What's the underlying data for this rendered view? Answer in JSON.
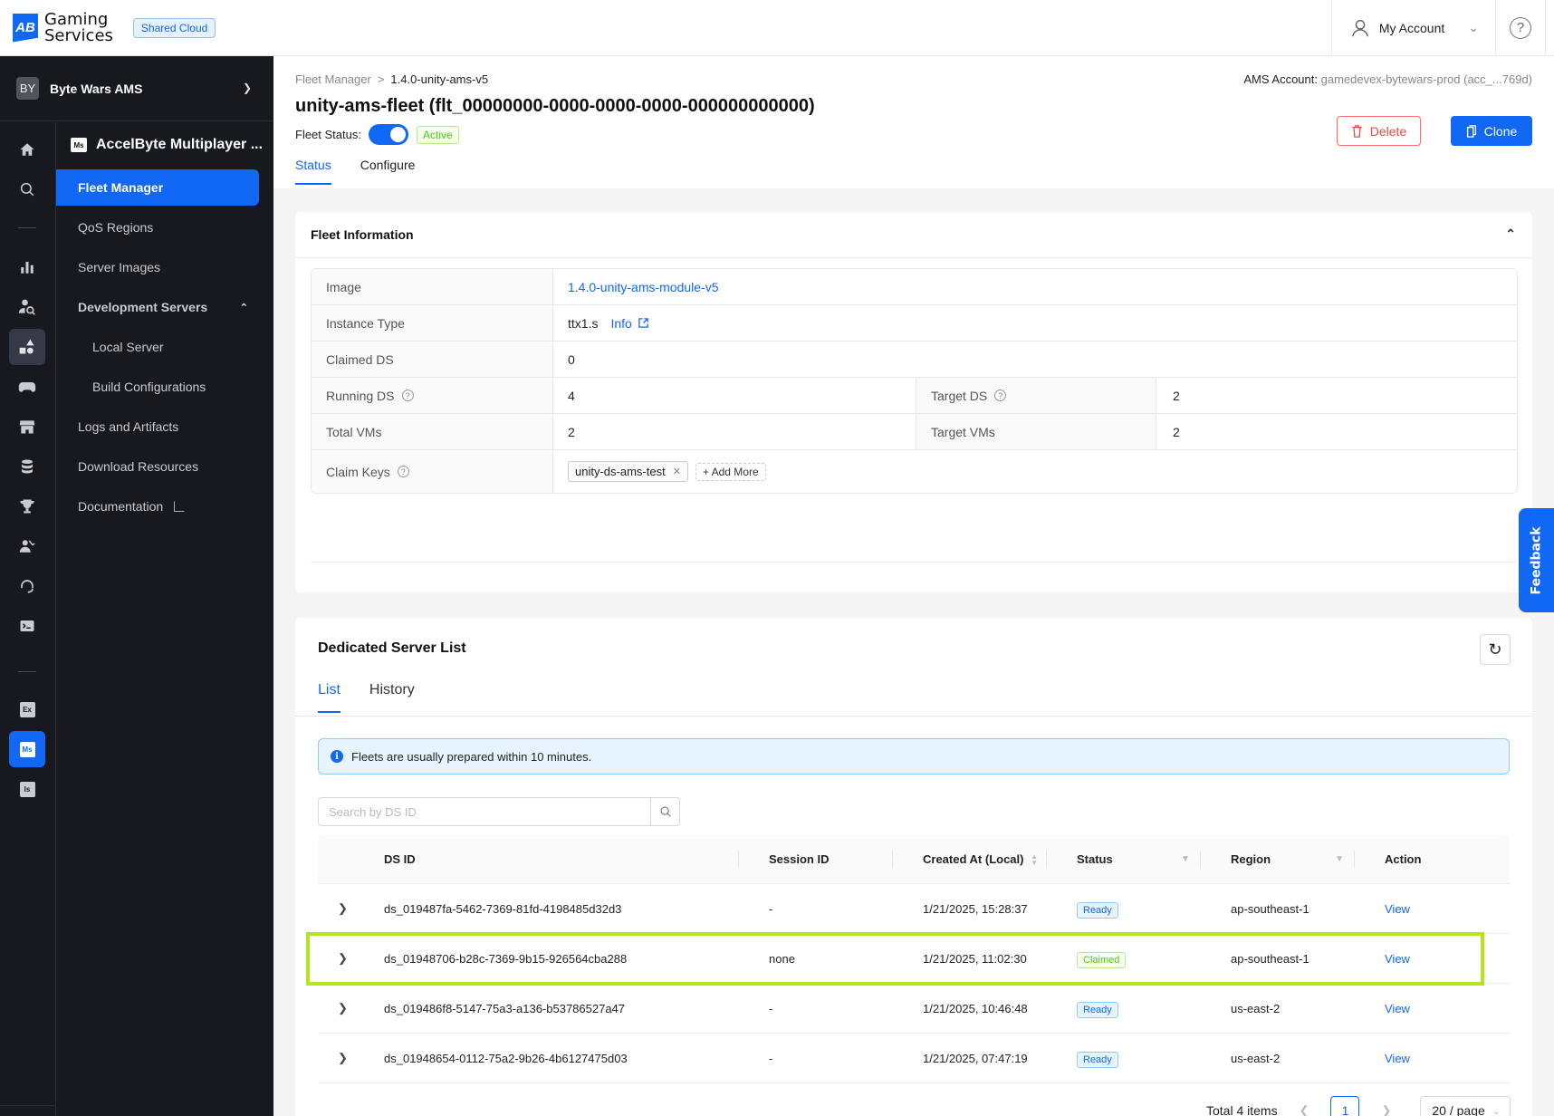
{
  "header": {
    "logo_mark": "AB",
    "logo_line1": "Gaming",
    "logo_line2": "Services",
    "environment_badge": "Shared Cloud",
    "account_label": "My Account",
    "help_icon": "?"
  },
  "sidebar": {
    "workspace_avatar": "BY",
    "workspace_name": "Byte Wars AMS",
    "module_icon": "Ms",
    "module_title": "AccelByte Multiplayer ...",
    "rail_icons": [
      "home-icon",
      "search-icon",
      "analytics-icon",
      "player-search-icon",
      "shapes-icon",
      "gamepad-icon",
      "store-icon",
      "database-icon",
      "trophy-icon",
      "social-icon",
      "headset-icon",
      "terminal-icon",
      "ex-icon",
      "ms-icon",
      "is-icon"
    ],
    "rail_labels": {
      "ex": "Ex",
      "ms": "Ms",
      "is": "Is"
    },
    "items": [
      {
        "label": "Fleet Manager",
        "active": true
      },
      {
        "label": "QoS Regions"
      },
      {
        "label": "Server Images"
      },
      {
        "label": "Development Servers",
        "group": true,
        "expanded": true
      },
      {
        "label": "Local Server",
        "sub": true
      },
      {
        "label": "Build Configurations",
        "sub": true
      },
      {
        "label": "Logs and Artifacts"
      },
      {
        "label": "Download Resources"
      },
      {
        "label": "Documentation",
        "external": true
      }
    ]
  },
  "page": {
    "breadcrumb": [
      "Fleet Manager",
      "1.4.0-unity-ams-v5"
    ],
    "breadcrumb_separator": ">",
    "ams_account_label": "AMS Account:",
    "ams_account_value": "gamedevex-bytewars-prod (acc_...769d)",
    "title": "unity-ams-fleet (flt_00000000-0000-0000-0000-000000000000)",
    "fleet_status_label": "Fleet Status:",
    "fleet_status_enabled": true,
    "fleet_status_badge": "Active",
    "delete_label": "Delete",
    "clone_label": "Clone",
    "tabs": [
      {
        "label": "Status",
        "active": true
      },
      {
        "label": "Configure"
      }
    ]
  },
  "fleet_info": {
    "title": "Fleet Information",
    "image_label": "Image",
    "image_value": "1.4.0-unity-ams-module-v5",
    "instance_type_label": "Instance Type",
    "instance_type_value": "ttx1.s",
    "instance_info_link": "Info",
    "claimed_ds_label": "Claimed DS",
    "claimed_ds_value": "0",
    "running_ds_label": "Running DS",
    "running_ds_value": "4",
    "target_ds_label": "Target DS",
    "target_ds_value": "2",
    "total_vms_label": "Total VMs",
    "total_vms_value": "2",
    "target_vms_label": "Target VMs",
    "target_vms_value": "2",
    "claim_keys_label": "Claim Keys",
    "claim_keys": [
      "unity-ds-ams-test"
    ],
    "add_more_label": "Add More"
  },
  "ds_list": {
    "title": "Dedicated Server List",
    "tabs": [
      {
        "label": "List",
        "active": true
      },
      {
        "label": "History"
      }
    ],
    "alert": "Fleets are usually prepared within 10 minutes.",
    "search_placeholder": "Search by DS ID",
    "search_value": "",
    "columns": [
      "DS ID",
      "Session ID",
      "Created At (Local)",
      "Status",
      "Region",
      "Action"
    ],
    "rows": [
      {
        "ds_id": "ds_019487fa-5462-7369-81fd-4198485d32d3",
        "session_id": "-",
        "created_at": "1/21/2025, 15:28:37",
        "status": "Ready",
        "region": "ap-southeast-1",
        "action": "View"
      },
      {
        "ds_id": "ds_01948706-b28c-7369-9b15-926564cba288",
        "session_id": "none",
        "created_at": "1/21/2025, 11:02:30",
        "status": "Claimed",
        "region": "ap-southeast-1",
        "action": "View",
        "highlighted": true
      },
      {
        "ds_id": "ds_019486f8-5147-75a3-a136-b53786527a47",
        "session_id": "-",
        "created_at": "1/21/2025, 10:46:48",
        "status": "Ready",
        "region": "us-east-2",
        "action": "View"
      },
      {
        "ds_id": "ds_01948654-0112-75a2-9b26-4b6127475d03",
        "session_id": "-",
        "created_at": "1/21/2025, 07:47:19",
        "status": "Ready",
        "region": "us-east-2",
        "action": "View"
      }
    ],
    "pagination": {
      "total_label": "Total 4 items",
      "current_page": "1",
      "page_size": "20 / page"
    }
  },
  "feedback_label": "Feedback",
  "colors": {
    "accent": "#1068f5",
    "highlight": "#b5e61d",
    "sidebar_bg": "#17191e",
    "success": "#52c41a",
    "danger": "#e84848"
  }
}
